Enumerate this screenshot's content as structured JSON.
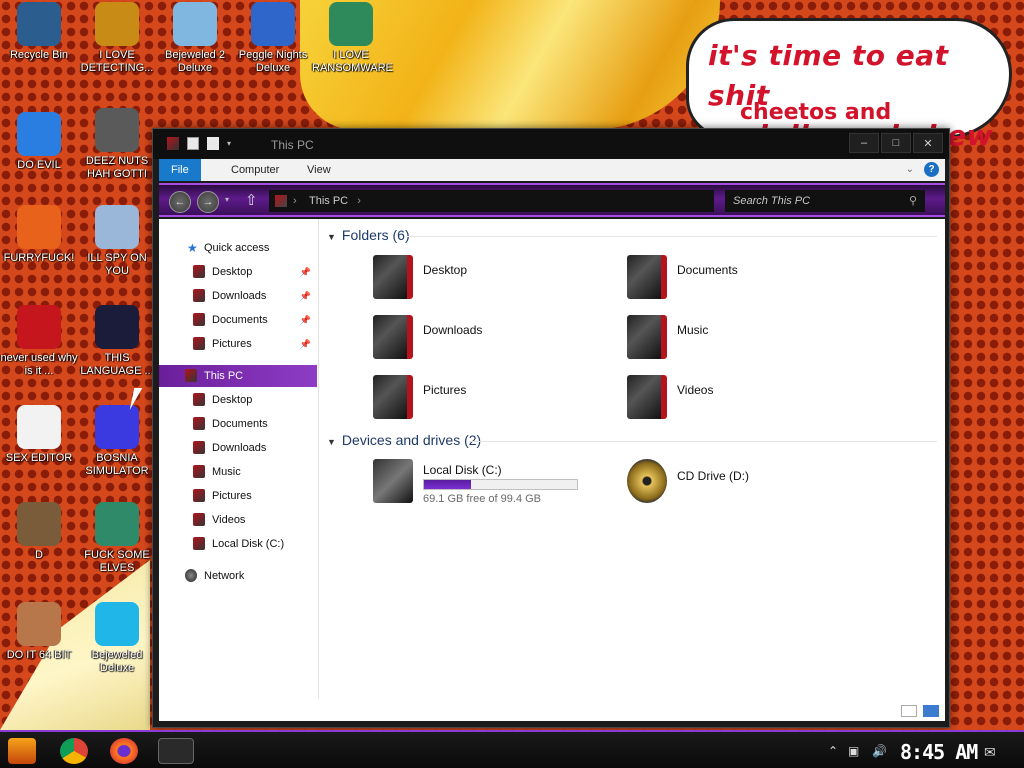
{
  "desktop": {
    "wallpaper_text_line1": "it's time to eat shit",
    "wallpaper_text_line2": "and die and chew",
    "wallpaper_text_line3": "cheetos and",
    "icons": [
      {
        "label": "Recycle Bin",
        "icon": "recycle-bin-icon",
        "color": "#2c5d8f"
      },
      {
        "label": "I LOVE DETECTING...",
        "icon": "detector-icon",
        "color": "#c78b16"
      },
      {
        "label": "Bejeweled 2 Deluxe",
        "icon": "bejeweled-icon",
        "color": "#7fb7e0"
      },
      {
        "label": "Peggle Nights Deluxe",
        "icon": "peggle-icon",
        "color": "#2e66c9"
      },
      {
        "label": "I LOVE RANSOMWARE",
        "icon": "project-icon",
        "color": "#2e8a5a"
      },
      {
        "label": "DO EVIL",
        "icon": "chrome-icon",
        "color": "#2a7de1"
      },
      {
        "label": "DEEZ NUTS HAH GOTTI",
        "icon": "windows-stack-icon",
        "color": "#5a5a5a"
      },
      {
        "label": "FURRYFUCK!",
        "icon": "firefox-icon",
        "color": "#e8621c"
      },
      {
        "label": "ILL SPY ON YOU",
        "icon": "spy-icon",
        "color": "#9ab6d8"
      },
      {
        "label": "never used why is it ...",
        "icon": "devcpp-icon",
        "color": "#c4161c"
      },
      {
        "label": "THIS LANGUAGE ...",
        "icon": "goland-icon",
        "color": "#1b1b3a"
      },
      {
        "label": "SEX EDITOR",
        "icon": "hxd-icon",
        "color": "#f2f2f2"
      },
      {
        "label": "BOSNIA SIMULATOR",
        "icon": "minesweeper-icon",
        "color": "#3a3ae0"
      },
      {
        "label": "D",
        "icon": "portrait-icon",
        "color": "#7a5c3a"
      },
      {
        "label": "FUCK SOME ELVES",
        "icon": "elves-icon",
        "color": "#2f8a6a"
      },
      {
        "label": "DO IT 64 BIT",
        "icon": "portrait-64-icon",
        "color": "#b7774a"
      },
      {
        "label": "Bejeweled Deluxe",
        "icon": "diamond-icon",
        "color": "#20b6e8"
      }
    ]
  },
  "window": {
    "title": "This PC",
    "ribbon_tabs": [
      "File",
      "Computer",
      "View"
    ],
    "help_label": "?",
    "address_text": "This PC",
    "search_placeholder": "Search This PC",
    "nav": {
      "quick_access": "Quick access",
      "quick_items": [
        "Desktop",
        "Downloads",
        "Documents",
        "Pictures"
      ],
      "this_pc": "This PC",
      "pc_items": [
        "Desktop",
        "Documents",
        "Downloads",
        "Music",
        "Pictures",
        "Videos",
        "Local Disk (C:)"
      ],
      "network": "Network"
    },
    "folders_header": "Folders (6)",
    "folders": [
      "Desktop",
      "Documents",
      "Downloads",
      "Music",
      "Pictures",
      "Videos"
    ],
    "drives_header": "Devices and drives (2)",
    "drives": [
      {
        "name": "Local Disk (C:)",
        "free_text": "69.1 GB free of 99.4 GB",
        "used_fraction": 0.305
      },
      {
        "name": "CD Drive (D:)"
      }
    ],
    "accent_color": "#7a2fd0"
  },
  "taskbar": {
    "time": "8:45 AM",
    "items": [
      "start-icon",
      "chrome-icon",
      "firefox-icon",
      "file-explorer-icon"
    ]
  }
}
